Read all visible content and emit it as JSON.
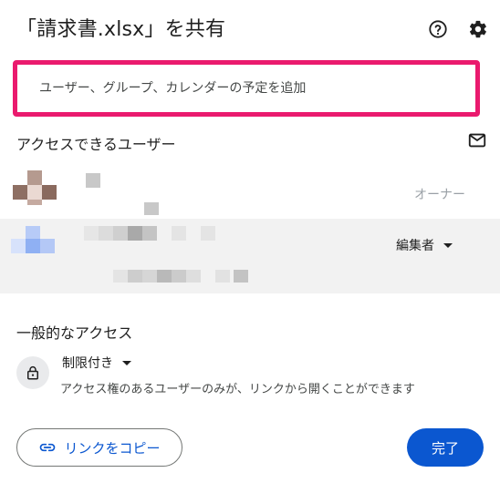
{
  "dialog": {
    "title": "「請求書.xlsx」を共有",
    "help_icon": "help-circle-icon",
    "settings_icon": "gear-icon"
  },
  "add_people": {
    "placeholder": "ユーザー、グループ、カレンダーの予定を追加"
  },
  "people_with_access": {
    "heading": "アクセスできるユーザー",
    "email_icon": "mail-icon",
    "owner": {
      "role": "オーナー"
    },
    "editor": {
      "role": "編集者"
    }
  },
  "general_access": {
    "heading": "一般的なアクセス",
    "lock_icon": "lock-icon",
    "setting": "制限付き",
    "description": "アクセス権のあるユーザーのみが、リンクから開くことができます"
  },
  "footer": {
    "copy_link_label": "リンクをコピー",
    "link_icon": "link-icon",
    "done_label": "完了"
  },
  "colors": {
    "highlight_border": "#ea1a6e",
    "primary": "#0b57d0",
    "selected_row": "#f2f2f2"
  }
}
